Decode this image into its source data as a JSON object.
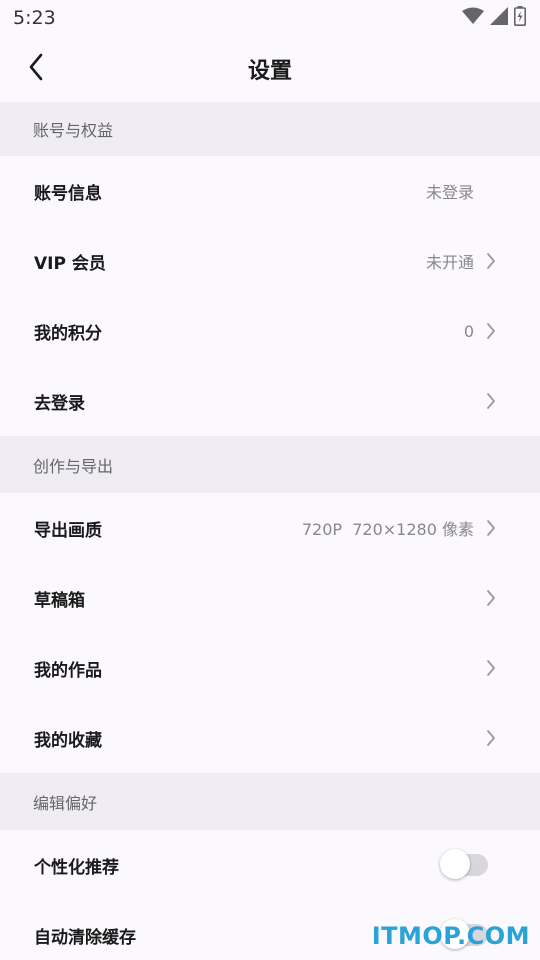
{
  "status_bar": {
    "time": "5:23",
    "icons": [
      "wifi-icon",
      "signal-icon",
      "battery-icon"
    ]
  },
  "header": {
    "title": "设置",
    "back_icon": "back-arrow-icon"
  },
  "sections": [
    {
      "title": "账号与权益",
      "rows": [
        {
          "label": "账号信息",
          "value": "未登录",
          "chevron": false
        },
        {
          "label": "VIP 会员",
          "value": "未开通",
          "chevron": true
        },
        {
          "label": "我的积分",
          "value": "0",
          "chevron": true
        },
        {
          "label": "去登录",
          "value": "",
          "chevron": true
        }
      ]
    },
    {
      "title": "创作与导出",
      "rows": [
        {
          "label": "导出画质",
          "value": "720P  720×1280 像素",
          "chevron": true
        },
        {
          "label": "草稿箱",
          "value": "",
          "chevron": true
        },
        {
          "label": "我的作品",
          "value": "",
          "chevron": true
        },
        {
          "label": "我的收藏",
          "value": "",
          "chevron": true
        }
      ]
    },
    {
      "title": "编辑偏好",
      "rows": [
        {
          "label": "个性化推荐",
          "toggle": false
        },
        {
          "label": "自动清除缓存",
          "toggle": false
        }
      ]
    }
  ],
  "watermark": "ITMOP.COM",
  "colors": {
    "background": "#fbf9fd",
    "section_bg": "#efedf3",
    "watermark": "#2aa4d8"
  }
}
